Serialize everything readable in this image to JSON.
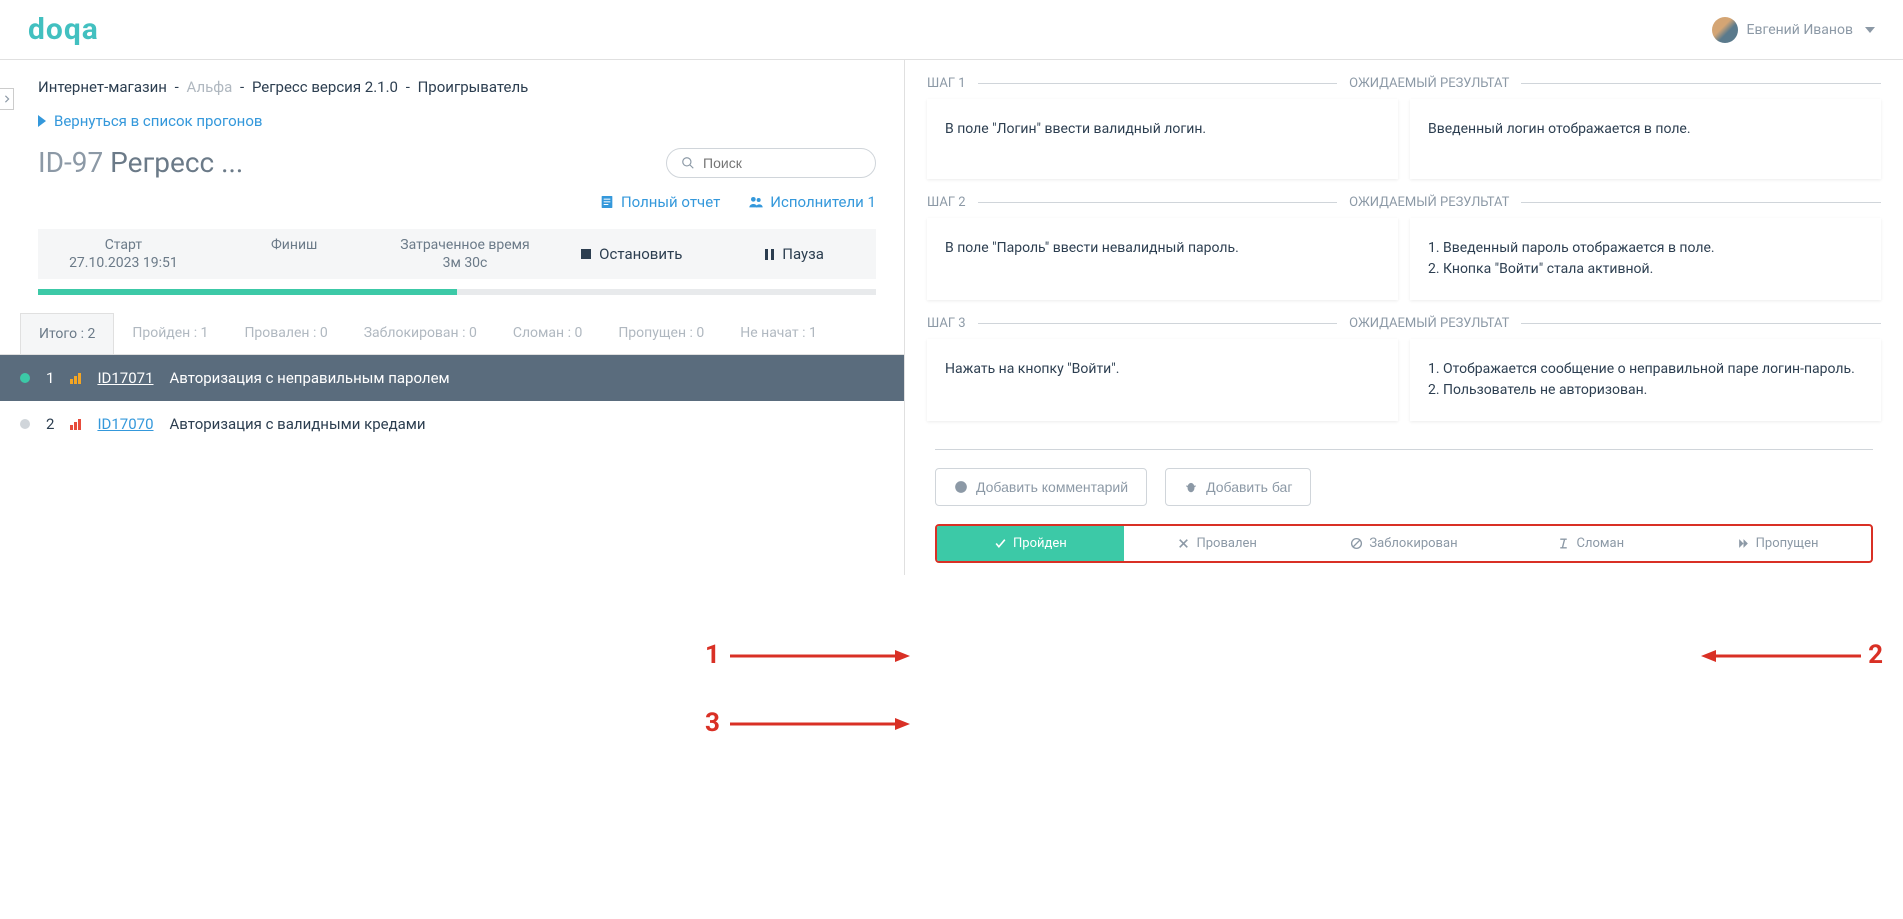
{
  "header": {
    "logo": "doqa",
    "user_name": "Евгений Иванов"
  },
  "breadcrumb": {
    "project": "Интернет-магазин",
    "env": "Альфа",
    "run": "Регресс версия 2.1.0",
    "page": "Проигрыватель"
  },
  "back_link": "Вернуться в список прогонов",
  "title_id": "ID-97",
  "title_name": "Регресс ...",
  "search_placeholder": "Поиск",
  "full_report": "Полный отчет",
  "performers": "Исполнители 1",
  "stats": {
    "start_label": "Старт",
    "start_value": "27.10.2023 19:51",
    "finish_label": "Финиш",
    "finish_value": "",
    "elapsed_label": "Затраченное время",
    "elapsed_value": "3м 30с",
    "stop": "Остановить",
    "pause": "Пауза"
  },
  "tabs": {
    "total": "Итого : 2",
    "passed": "Пройден : 1",
    "failed": "Провален : 0",
    "blocked": "Заблокирован : 0",
    "broken": "Сломан : 0",
    "skipped": "Пропущен : 0",
    "not_started": "Не начат : 1"
  },
  "tests": [
    {
      "num": "1",
      "id": "ID17071",
      "name": "Авторизация с неправильным паролем"
    },
    {
      "num": "2",
      "id": "ID17070",
      "name": "Авторизация с валидными кредами"
    }
  ],
  "steps": [
    {
      "step_label": "ШАГ 1",
      "result_label": "ОЖИДАЕМЫЙ РЕЗУЛЬТАТ",
      "step_text": "В поле \"Логин\" ввести валидный логин.",
      "result_text": "Введенный логин отображается в поле."
    },
    {
      "step_label": "ШАГ 2",
      "result_label": "ОЖИДАЕМЫЙ РЕЗУЛЬТАТ",
      "step_text": "В поле \"Пароль\" ввести невалидный пароль.",
      "result_text": "1. Введенный пароль отображается в поле.\n2. Кнопка \"Войти\" стала активной."
    },
    {
      "step_label": "ШАГ 3",
      "result_label": "ОЖИДАЕМЫЙ РЕЗУЛЬТАТ",
      "step_text": "Нажать на кнопку \"Войти\".",
      "result_text": "1. Отображается сообщение о неправильной паре логин-пароль.\n2. Пользователь не авторизован."
    }
  ],
  "add_comment": "Добавить комментарий",
  "add_bug": "Добавить баг",
  "status_buttons": {
    "passed": "Пройден",
    "failed": "Провален",
    "blocked": "Заблокирован",
    "broken": "Сломан",
    "skipped": "Пропущен"
  },
  "annotations": {
    "one": "1",
    "two": "2",
    "three": "3"
  }
}
